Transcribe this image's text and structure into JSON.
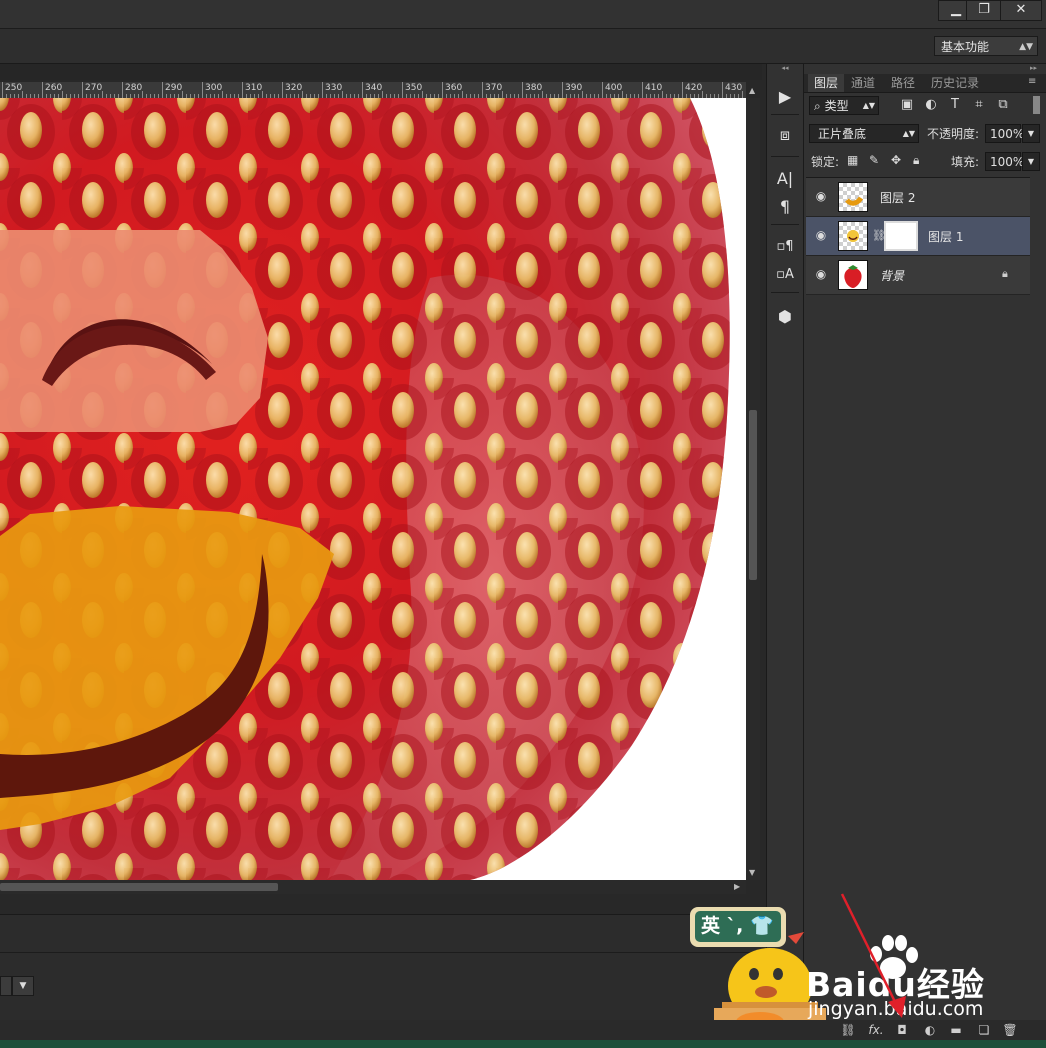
{
  "window": {
    "min_icon": "minimize-icon",
    "restore_icon": "restore-icon",
    "close_icon": "close-icon"
  },
  "options_bar": {
    "workspace": "基本功能"
  },
  "ruler": {
    "labels": [
      "250",
      "260",
      "270",
      "280",
      "290",
      "300",
      "310",
      "320",
      "330",
      "340",
      "350",
      "360",
      "370",
      "380",
      "390",
      "400",
      "410",
      "420",
      "430"
    ]
  },
  "tools": [
    "play-icon",
    "3d-cube-icon",
    "character-icon",
    "paragraph-icon",
    "char-style-icon",
    "para-style-icon",
    "3d-object-icon"
  ],
  "layers_panel": {
    "tabs": [
      "图层",
      "通道",
      "路径",
      "历史记录"
    ],
    "active_tab": "图层",
    "filter_label": "类型",
    "blend_mode": "正片叠底",
    "opacity_label": "不透明度:",
    "opacity_value": "100%",
    "lock_label": "锁定:",
    "fill_label": "填充:",
    "fill_value": "100%",
    "layers": [
      {
        "name": "图层 2",
        "selected": false,
        "has_mask": false,
        "locked": false
      },
      {
        "name": "图层 1",
        "selected": true,
        "has_mask": true,
        "locked": false
      },
      {
        "name": "背景",
        "selected": false,
        "has_mask": false,
        "locked": true
      }
    ],
    "bottom_icons": [
      "link-icon",
      "fx-icon",
      "add-mask-icon",
      "adjustment-icon",
      "folder-icon",
      "new-layer-icon",
      "trash-icon"
    ],
    "fx_label": "fx."
  },
  "ime": {
    "label": "英 ˋ, 👕"
  },
  "watermark": {
    "brand": "Baidu经验",
    "url": "jingyan.baidu.com"
  },
  "colors": {
    "selected_layer": "#4b5367",
    "panel_bg": "#323232",
    "arrow": "#e0202a"
  }
}
